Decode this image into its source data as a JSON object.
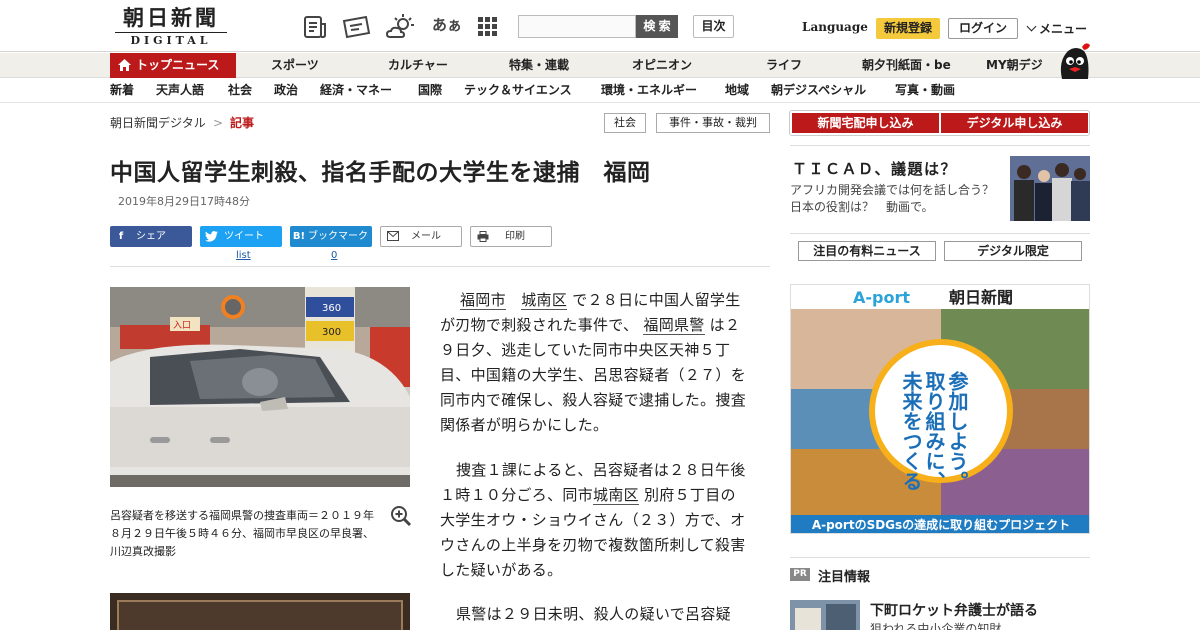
{
  "header": {
    "logo_jp": "朝日新聞",
    "logo_en": "DIGITAL",
    "kana_icon_text": "あぁ",
    "search_placeholder": "",
    "search_button": "検 索",
    "index_button": "目次",
    "language": "Language",
    "register": "新規登録",
    "login": "ログイン",
    "menu": "メニュー"
  },
  "nav1": {
    "top": "トップニュース",
    "items": [
      "スポーツ",
      "カルチャー",
      "特集・連載",
      "オピニオン",
      "ライフ",
      "朝夕刊紙面・be",
      "MY朝デジ"
    ]
  },
  "nav2": {
    "items": [
      "新着",
      "天声人語",
      "社会",
      "政治",
      "経済・マネー",
      "国際",
      "テック＆サイエンス",
      "環境・エネルギー",
      "地域",
      "朝デジスペシャル",
      "写真・動画"
    ]
  },
  "breadcrumb": {
    "home": "朝日新聞デジタル",
    "sep": ">",
    "current": "記事",
    "tags": [
      "社会",
      "事件・事故・裁判"
    ]
  },
  "article": {
    "title": "中国人留学生刺殺、指名手配の大学生を逮捕　福岡",
    "date": "2019年8月29日17時48分",
    "share": {
      "facebook": "シェア",
      "facebook_icon": "f",
      "twitter": "ツイート",
      "twitter_sub": "list",
      "hatena": "ブックマーク",
      "hatena_icon": "B!",
      "hatena_count": "0",
      "mail": "メール",
      "print": "印刷"
    },
    "caption": "呂容疑者を移送する福岡県警の捜査車両＝２０１９年８月２９日午後５時４６分、福岡市早良区の早良署、川辺真改撮影",
    "photo_sign1": "360",
    "photo_sign2": "300",
    "photo_sign3": "入口",
    "p1": {
      "l1": "福岡市",
      "l2": "城南区",
      "t1": "で２８日に中国人留学生が刃物で刺殺された事件で、",
      "l3": "福岡県警",
      "t2": "は２９日夕、逃走していた同市中央区天神５丁目、中国籍の大学生、呂思容疑者（２７）を同市内で確保し、殺人容疑で逮捕した。捜査関係者が明らかにした。"
    },
    "p2": {
      "t1": "捜査１課によると、呂容疑者は２８日午後１時１０分ごろ、同市",
      "l1": "城南区",
      "t2": "別府５丁目の大学生オウ・ショウイさん（２３）方で、オウさんの上半身を刃物で複数箇所刺して殺害した疑いがある。"
    },
    "p3": "県警は２９日未明、殺人の疑いで呂容疑"
  },
  "sidebar": {
    "red_buttons": [
      "新聞宅配申し込み",
      "デジタル申し込み"
    ],
    "ticad_title": "ＴＩＣＡＤ、議題は？",
    "ticad_desc": "アフリカ開発会議では何を話し合う？　日本の役割は？　動画で。",
    "buttons": [
      "注目の有料ニュース",
      "デジタル限定"
    ],
    "ad_brand": "A-port",
    "ad_paper": "朝日新聞",
    "ad_copy": [
      "未来をつくる",
      "取り組みに、",
      "参加しよう。"
    ],
    "ad_footer": "A-portのSDGsの達成に取り組むプロジェクト",
    "pr_badge": "PR",
    "pr_label": "注目情報",
    "pr_title": "下町ロケット弁護士が語る",
    "pr_sub": "狙われる中小企業の知財"
  }
}
